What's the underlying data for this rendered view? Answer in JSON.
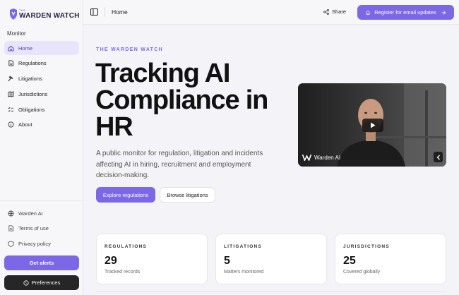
{
  "brand": {
    "small": "THE",
    "name": "WARDEN WATCH"
  },
  "sidebar": {
    "section": "Monitor",
    "items": [
      {
        "label": "Home",
        "icon": "home-icon"
      },
      {
        "label": "Regulations",
        "icon": "document-icon"
      },
      {
        "label": "Litigations",
        "icon": "gavel-icon"
      },
      {
        "label": "Jurisdictions",
        "icon": "map-icon"
      },
      {
        "label": "Obligations",
        "icon": "checklist-icon"
      },
      {
        "label": "About",
        "icon": "info-icon"
      }
    ],
    "footer": [
      {
        "label": "Warden AI",
        "icon": "globe-icon"
      },
      {
        "label": "Terms of use",
        "icon": "document-icon"
      },
      {
        "label": "Privacy policy",
        "icon": "shield-icon"
      }
    ],
    "alerts_label": "Get alerts",
    "preferences_label": "Preferences"
  },
  "topbar": {
    "breadcrumb": "Home",
    "share_label": "Share",
    "register_label": "Register for email updates"
  },
  "hero": {
    "eyebrow": "THE WARDEN WATCH",
    "title": "Tracking AI Compliance in HR",
    "description": "A public monitor for regulation, litigation and incidents affecting AI in hiring, recruitment and employment decision-making.",
    "primary_label": "Explore regulations",
    "secondary_label": "Browse litigations"
  },
  "video": {
    "brand": "Warden AI"
  },
  "stats": [
    {
      "label": "REGULATIONS",
      "value": "29",
      "caption": "Tracked records"
    },
    {
      "label": "LITIGATIONS",
      "value": "5",
      "caption": "Matters monitored"
    },
    {
      "label": "JURISDICTIONS",
      "value": "25",
      "caption": "Covered globally"
    }
  ],
  "colors": {
    "accent": "#7c67e6",
    "active_bg": "#e7e4fb",
    "dark_button": "#262626"
  }
}
